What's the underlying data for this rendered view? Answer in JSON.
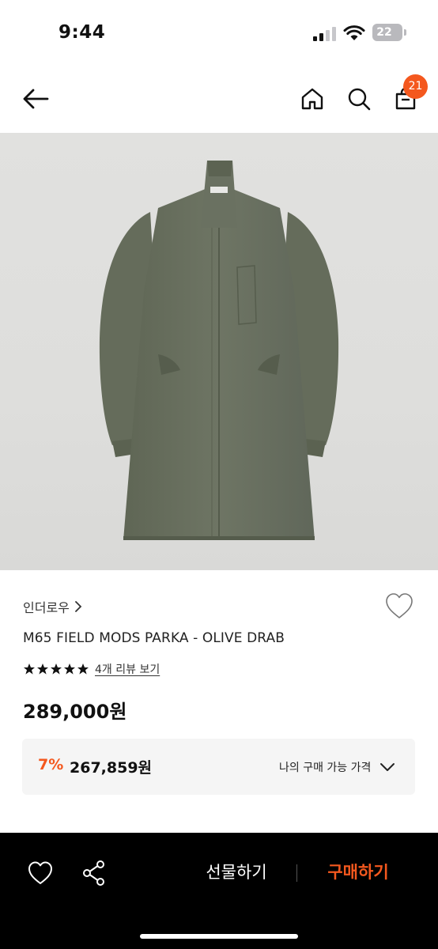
{
  "status_bar": {
    "time": "9:44",
    "battery": "22",
    "icons": [
      "signal-icon",
      "wifi-icon",
      "battery-icon"
    ]
  },
  "header": {
    "icons": [
      "back-arrow-icon",
      "home-icon",
      "search-icon",
      "shopping-bag-icon"
    ],
    "cart_count": "21"
  },
  "product": {
    "image": "olive-parka-icon",
    "brand": "인더로우",
    "name": "M65 FIELD MODS PARKA - OLIVE DRAB",
    "rating_stars": 5,
    "review_link": "4개 리뷰 보기",
    "price": "289,000원"
  },
  "discount": {
    "rate": "7%",
    "price": "267,859원",
    "label": "나의 구매 가능 가격"
  },
  "bottom_bar": {
    "icons": [
      "heart-outline-icon",
      "share-icon"
    ],
    "gift_label": "선물하기",
    "buy_label": "구매하기"
  },
  "colors": {
    "accent": "#f4581e",
    "coat": "#69705f",
    "background_image": "#dfdfdd"
  }
}
